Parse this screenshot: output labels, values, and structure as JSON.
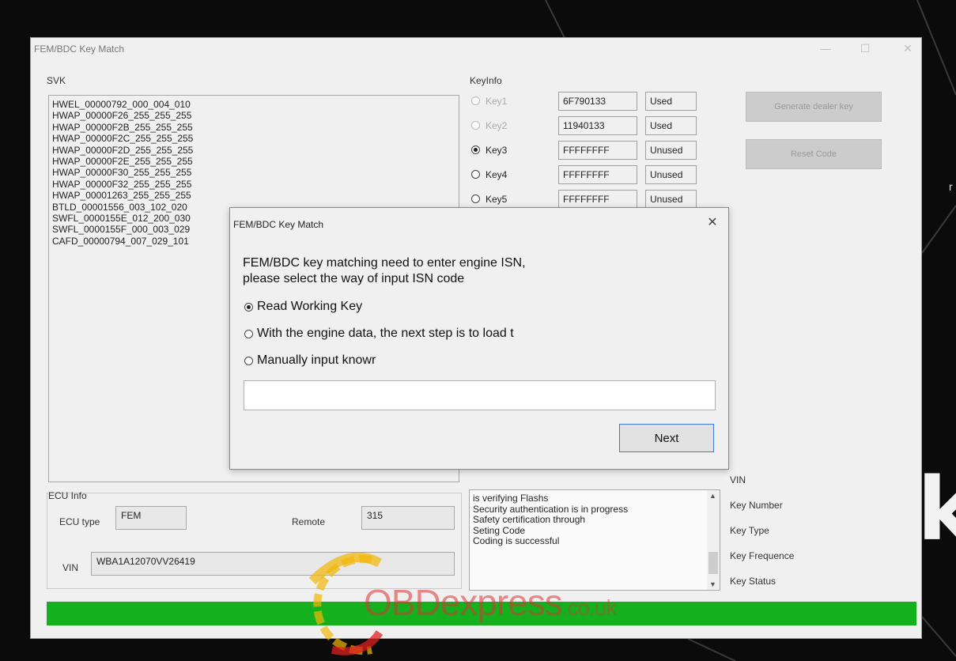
{
  "main_window": {
    "title": "FEM/BDC Key Match",
    "controls": {
      "minimize": "—",
      "maximize": "☐",
      "close": "✕"
    }
  },
  "svk": {
    "label": "SVK",
    "items": [
      "HWEL_00000792_000_004_010",
      "HWAP_00000F26_255_255_255",
      "HWAP_00000F2B_255_255_255",
      "HWAP_00000F2C_255_255_255",
      "HWAP_00000F2D_255_255_255",
      "HWAP_00000F2E_255_255_255",
      "HWAP_00000F30_255_255_255",
      "HWAP_00000F32_255_255_255",
      "HWAP_00001263_255_255_255",
      "BTLD_00001556_003_102_020",
      "SWFL_0000155E_012_200_030",
      "SWFL_0000155F_000_003_029",
      "CAFD_00000794_007_029_101"
    ]
  },
  "keyinfo": {
    "label": "KeyInfo",
    "keys": [
      {
        "label": "Key1",
        "value": "6F790133",
        "status": "Used"
      },
      {
        "label": "Key2",
        "value": "11940133",
        "status": "Used"
      },
      {
        "label": "Key3",
        "value": "FFFFFFFF",
        "status": "Unused"
      },
      {
        "label": "Key4",
        "value": "FFFFFFFF",
        "status": "Unused"
      },
      {
        "label": "Key5",
        "value": "FFFFFFFF",
        "status": "Unused"
      }
    ]
  },
  "buttons": {
    "generate_dealer_key": "Generate dealer key",
    "reset_code": "Reset Code"
  },
  "ecu_info": {
    "label": "ECU Info",
    "ecu_type_label": "ECU type",
    "ecu_type_value": "FEM",
    "remote_label": "Remote",
    "remote_value": "315",
    "vin_label": "VIN",
    "vin_value": "WBA1A12070VV26419"
  },
  "log": {
    "lines": [
      "is verifying Flashs",
      "Security authentication is in progress",
      "Safety certification through",
      "Seting Code",
      "Coding is successful"
    ]
  },
  "key_details": {
    "vin": "VIN",
    "key_number": "Key Number",
    "key_type": "Key Type",
    "key_frequence": "Key Frequence",
    "key_status": "Key Status"
  },
  "progress": {
    "value": 1.0,
    "color": "#14b01e"
  },
  "watermark": {
    "brand": "OBDexpress",
    "domain": ".co.uk"
  },
  "background": {
    "letters": "k",
    "small_char": "r"
  },
  "dialog": {
    "title": "FEM/BDC Key Match",
    "close": "✕",
    "message_line1": "FEM/BDC key matching need to enter engine ISN,",
    "message_line2": "please select the way of input ISN code",
    "options": [
      "Read Working Key",
      "With the engine data, the next step is to load t",
      "Manually input knowr"
    ],
    "input_value": "",
    "next_label": "Next"
  }
}
